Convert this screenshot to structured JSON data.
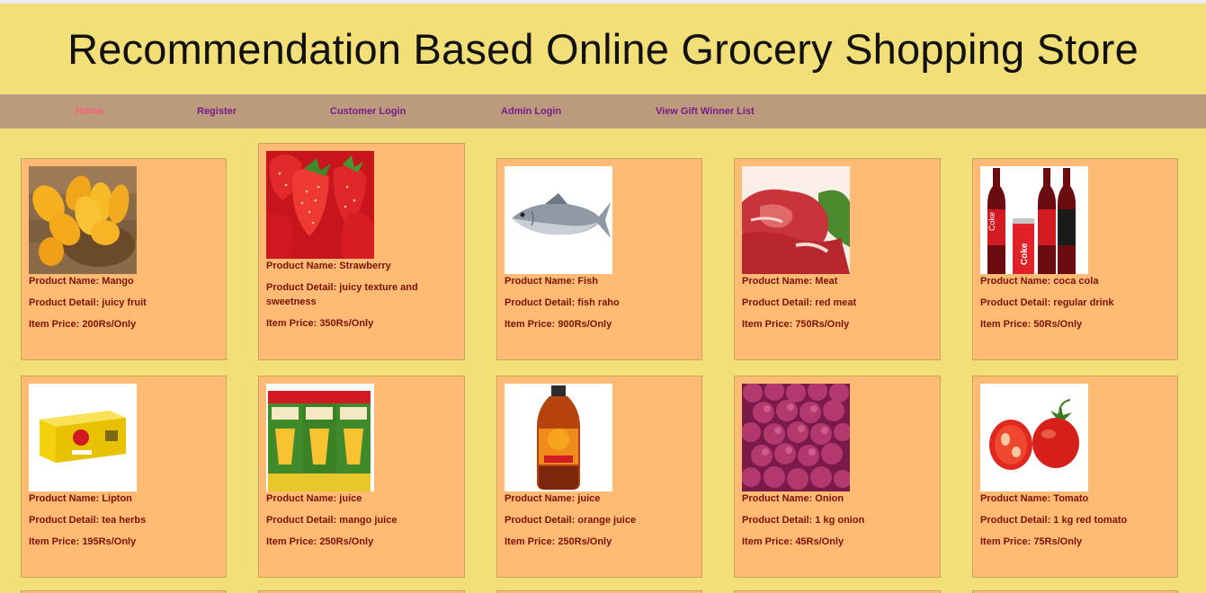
{
  "site": {
    "title": "Recommendation Based Online Grocery Shopping Store"
  },
  "nav": {
    "items": [
      {
        "label": "Home",
        "active": true
      },
      {
        "label": "Register"
      },
      {
        "label": "Customer Login"
      },
      {
        "label": "Admin Login"
      },
      {
        "label": "View Gift Winner List"
      }
    ]
  },
  "labels": {
    "name": "Product Name: ",
    "detail": "Product Detail: ",
    "price": "Item Price: "
  },
  "products": [
    {
      "name": "Mango",
      "detail": "juicy fruit",
      "price": "200Rs/Only",
      "icon": "mango-image"
    },
    {
      "name": "Strawberry",
      "detail": "juicy texture and sweetness",
      "price": "350Rs/Only",
      "icon": "strawberry-image"
    },
    {
      "name": "Fish",
      "detail": "fish raho",
      "price": "900Rs/Only",
      "icon": "fish-image"
    },
    {
      "name": "Meat",
      "detail": "red meat",
      "price": "750Rs/Only",
      "icon": "meat-image"
    },
    {
      "name": "coca cola",
      "detail": "regular drink",
      "price": "50Rs/Only",
      "icon": "coca-cola-image"
    },
    {
      "name": "Lipton",
      "detail": "tea herbs",
      "price": "195Rs/Only",
      "icon": "lipton-tea-image"
    },
    {
      "name": "juice",
      "detail": "mango juice",
      "price": "250Rs/Only",
      "icon": "mango-juice-image"
    },
    {
      "name": "juice",
      "detail": "orange juice",
      "price": "250Rs/Only",
      "icon": "orange-juice-image"
    },
    {
      "name": "Onion",
      "detail": "1 kg onion",
      "price": "45Rs/Only",
      "icon": "onion-image"
    },
    {
      "name": "Tomato",
      "detail": "1 kg red tomato",
      "price": "75Rs/Only",
      "icon": "tomato-image"
    }
  ],
  "colors": {
    "background": "#f2df78",
    "nav": "#bc9b7c",
    "nav_link": "#7a1a8c",
    "nav_active": "#ff5a78",
    "card": "#ffbb73",
    "card_text": "#7a1208"
  }
}
